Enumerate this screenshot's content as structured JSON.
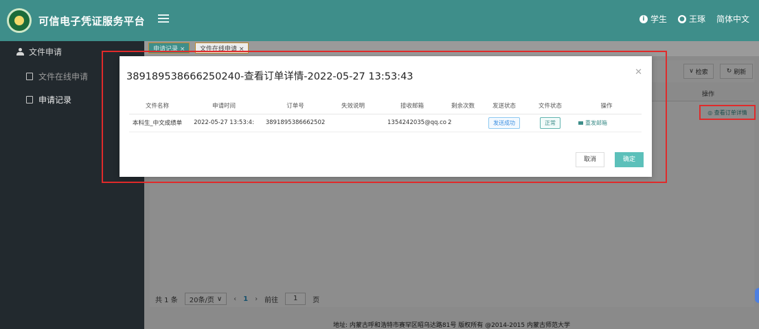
{
  "header": {
    "app_title": "可信电子凭证服务平台",
    "role": "学生",
    "user": "王琢",
    "language": "简体中文"
  },
  "sidebar": {
    "section": "文件申请",
    "items": [
      {
        "label": "文件在线申请"
      },
      {
        "label": "申请记录"
      }
    ]
  },
  "tabs": [
    {
      "label": "申请记录 ×"
    },
    {
      "label": "文件在线申请 ×"
    }
  ],
  "toolbar": {
    "search_label": "检索",
    "refresh_label": "刷新"
  },
  "list": {
    "op_header": "操作",
    "row_action": "查看订单详情"
  },
  "modal": {
    "title": "389189538666250240-查看订单详情-2022-05-27 13:53:43",
    "columns": [
      "文件名称",
      "申请时间",
      "订单号",
      "失效说明",
      "接收邮箱",
      "剩余次数",
      "发送状态",
      "文件状态",
      "操作"
    ],
    "row": {
      "file_name": "本科生_中文成绩单",
      "apply_time": "2022-05-27 13:53:4:",
      "order_no": "3891895386662502",
      "invalid_note": "",
      "email": "1354242035@qq.co",
      "remaining": "2",
      "send_status": "发送成功",
      "file_status": "正常",
      "action": "重发邮箱"
    },
    "cancel_label": "取消",
    "ok_label": "确定"
  },
  "pagination": {
    "total": "共 1 条",
    "page_size": "20条/页",
    "current_page": "1",
    "goto_label": "前往",
    "goto_value": "1",
    "page_unit": "页"
  },
  "footer": {
    "text": "地址: 内蒙古呼和浩特市赛罕区昭乌达路81号 版权所有 @2014-2015 内蒙古师范大学"
  },
  "colors": {
    "header_bg": "#3e8e8a",
    "sidebar_bg": "#22292e",
    "accent": "#5cc0ba",
    "highlight": "#e02a2a"
  }
}
